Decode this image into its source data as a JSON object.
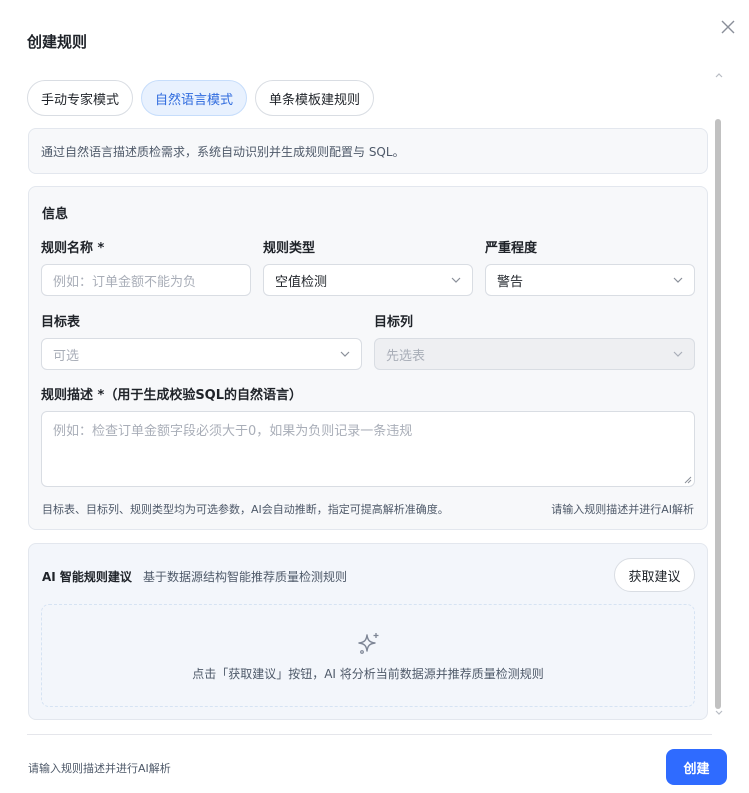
{
  "dialog": {
    "title": "创建规则",
    "close_icon": "close-icon"
  },
  "tabs": [
    {
      "label": "手动专家模式",
      "active": false
    },
    {
      "label": "自然语言模式",
      "active": true
    },
    {
      "label": "单条模板建规则",
      "active": false
    }
  ],
  "hint": "通过自然语言描述质检需求，系统自动识别并生成规则配置与 SQL。",
  "info": {
    "title": "信息",
    "rule_name": {
      "label": "规则名称 *",
      "placeholder": "例如：订单金额不能为负"
    },
    "rule_type": {
      "label": "规则类型",
      "value": "空值检测"
    },
    "severity": {
      "label": "严重程度",
      "value": "警告"
    },
    "target_table": {
      "label": "目标表",
      "placeholder": "可选"
    },
    "target_column": {
      "label": "目标列",
      "placeholder": "先选表"
    },
    "description": {
      "label": "规则描述 *（用于生成校验SQL的自然语言）",
      "placeholder": "例如：检查订单金额字段必须大于0，如果为负则记录一条违规"
    },
    "footnote": "目标表、目标列、规则类型均为可选参数，AI会自动推断，指定可提高解析准确度。",
    "status": "请输入规则描述并进行AI解析"
  },
  "ai": {
    "title": "AI 智能规则建议",
    "subtitle": "基于数据源结构智能推荐质量检测规则",
    "button": "获取建议",
    "empty_icon": "sparkle-icon",
    "empty_text": "点击「获取建议」按钮，AI 将分析当前数据源并推荐质量检测规则"
  },
  "footer": {
    "status": "请输入规则描述并进行AI解析",
    "create_label": "创建"
  },
  "colors": {
    "primary": "#2f6bff",
    "tab_active_bg": "#e8f1fe",
    "tab_active_text": "#2f6bde"
  }
}
